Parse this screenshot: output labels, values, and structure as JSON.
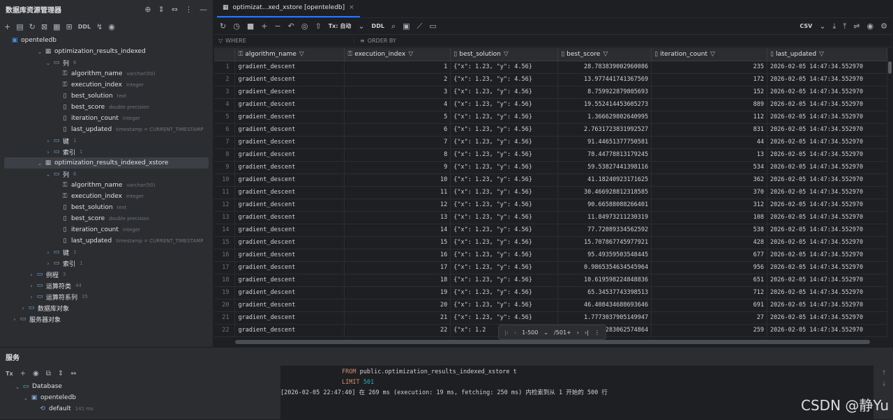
{
  "left_panel": {
    "title": "数据库资源管理器",
    "toolbar_ddl": "DDL",
    "tree": [
      {
        "depth": 0,
        "twist": "",
        "icon": "db",
        "label": "openteledb",
        "hint": ""
      },
      {
        "depth": 4,
        "twist": "⌄",
        "icon": "table",
        "label": "optimization_results_indexed",
        "hint": ""
      },
      {
        "depth": 5,
        "twist": "⌄",
        "icon": "folder",
        "label": "列",
        "hint": "6"
      },
      {
        "depth": 6,
        "twist": "",
        "icon": "key-col",
        "label": "algorithm_name",
        "hint": "varchar(50)"
      },
      {
        "depth": 6,
        "twist": "",
        "icon": "key-col",
        "label": "execution_index",
        "hint": "integer"
      },
      {
        "depth": 6,
        "twist": "",
        "icon": "col",
        "label": "best_solution",
        "hint": "text"
      },
      {
        "depth": 6,
        "twist": "",
        "icon": "col",
        "label": "best_score",
        "hint": "double precision"
      },
      {
        "depth": 6,
        "twist": "",
        "icon": "col",
        "label": "iteration_count",
        "hint": "integer"
      },
      {
        "depth": 6,
        "twist": "",
        "icon": "col",
        "label": "last_updated",
        "hint": "timestamp = CURRENT_TIMESTAMP"
      },
      {
        "depth": 5,
        "twist": "›",
        "icon": "folder",
        "label": "键",
        "hint": "1"
      },
      {
        "depth": 5,
        "twist": "›",
        "icon": "folder",
        "label": "索引",
        "hint": "1"
      },
      {
        "depth": 4,
        "twist": "⌄",
        "icon": "table",
        "label": "optimization_results_indexed_xstore",
        "hint": "",
        "selected": true
      },
      {
        "depth": 5,
        "twist": "⌄",
        "icon": "folder",
        "label": "列",
        "hint": "6"
      },
      {
        "depth": 6,
        "twist": "",
        "icon": "key-col",
        "label": "algorithm_name",
        "hint": "varchar(50)"
      },
      {
        "depth": 6,
        "twist": "",
        "icon": "key-col",
        "label": "execution_index",
        "hint": "integer"
      },
      {
        "depth": 6,
        "twist": "",
        "icon": "col",
        "label": "best_solution",
        "hint": "text"
      },
      {
        "depth": 6,
        "twist": "",
        "icon": "col",
        "label": "best_score",
        "hint": "double precision"
      },
      {
        "depth": 6,
        "twist": "",
        "icon": "col",
        "label": "iteration_count",
        "hint": "integer"
      },
      {
        "depth": 6,
        "twist": "",
        "icon": "col",
        "label": "last_updated",
        "hint": "timestamp = CURRENT_TIMESTAMP"
      },
      {
        "depth": 5,
        "twist": "›",
        "icon": "folder",
        "label": "键",
        "hint": "1"
      },
      {
        "depth": 5,
        "twist": "›",
        "icon": "folder",
        "label": "索引",
        "hint": "1"
      },
      {
        "depth": 3,
        "twist": "›",
        "icon": "folder",
        "label": "例程",
        "hint": "3"
      },
      {
        "depth": 3,
        "twist": "›",
        "icon": "folder",
        "label": "运算符类",
        "hint": "44"
      },
      {
        "depth": 3,
        "twist": "›",
        "icon": "folder",
        "label": "运算符系列",
        "hint": "35"
      },
      {
        "depth": 2,
        "twist": "›",
        "icon": "folder",
        "label": "数据库对象",
        "hint": ""
      },
      {
        "depth": 1,
        "twist": "›",
        "icon": "folder",
        "label": "服务器对象",
        "hint": ""
      }
    ]
  },
  "editor": {
    "tab_label": "optimizat...xed_xstore [openteledb]",
    "tx_label": "Tx: 自动",
    "ddl_label": "DDL",
    "export_format": "CSV",
    "where_label": "WHERE",
    "order_label": "ORDER BY"
  },
  "grid": {
    "columns": [
      "algorithm_name",
      "execution_index",
      "best_solution",
      "best_score",
      "iteration_count",
      "last_updated"
    ],
    "rows": [
      [
        "1",
        "gradient_descent",
        "1",
        "{\"x\": 1.23, \"y\": 4.56}",
        "28.783839002960086",
        "235",
        "2026-02-05 14:47:34.552970"
      ],
      [
        "2",
        "gradient_descent",
        "2",
        "{\"x\": 1.23, \"y\": 4.56}",
        "13.977441741367569",
        "172",
        "2026-02-05 14:47:34.552970"
      ],
      [
        "3",
        "gradient_descent",
        "3",
        "{\"x\": 1.23, \"y\": 4.56}",
        "8.759922879805693",
        "152",
        "2026-02-05 14:47:34.552970"
      ],
      [
        "4",
        "gradient_descent",
        "4",
        "{\"x\": 1.23, \"y\": 4.56}",
        "19.552414453605273",
        "889",
        "2026-02-05 14:47:34.552970"
      ],
      [
        "5",
        "gradient_descent",
        "5",
        "{\"x\": 1.23, \"y\": 4.56}",
        "1.366629802640995",
        "112",
        "2026-02-05 14:47:34.552970"
      ],
      [
        "6",
        "gradient_descent",
        "6",
        "{\"x\": 1.23, \"y\": 4.56}",
        "2.7631723831992527",
        "831",
        "2026-02-05 14:47:34.552970"
      ],
      [
        "7",
        "gradient_descent",
        "7",
        "{\"x\": 1.23, \"y\": 4.56}",
        "91.44651377750581",
        "44",
        "2026-02-05 14:47:34.552970"
      ],
      [
        "8",
        "gradient_descent",
        "8",
        "{\"x\": 1.23, \"y\": 4.56}",
        "78.44778813179245",
        "13",
        "2026-02-05 14:47:34.552970"
      ],
      [
        "9",
        "gradient_descent",
        "9",
        "{\"x\": 1.23, \"y\": 4.56}",
        "59.53827441398116",
        "534",
        "2026-02-05 14:47:34.552970"
      ],
      [
        "10",
        "gradient_descent",
        "10",
        "{\"x\": 1.23, \"y\": 4.56}",
        "41.18240923171625",
        "362",
        "2026-02-05 14:47:34.552970"
      ],
      [
        "11",
        "gradient_descent",
        "11",
        "{\"x\": 1.23, \"y\": 4.56}",
        "30.466928812318585",
        "370",
        "2026-02-05 14:47:34.552970"
      ],
      [
        "12",
        "gradient_descent",
        "12",
        "{\"x\": 1.23, \"y\": 4.56}",
        "90.66588088266401",
        "312",
        "2026-02-05 14:47:34.552970"
      ],
      [
        "13",
        "gradient_descent",
        "13",
        "{\"x\": 1.23, \"y\": 4.56}",
        "11.84973211230319",
        "108",
        "2026-02-05 14:47:34.552970"
      ],
      [
        "14",
        "gradient_descent",
        "14",
        "{\"x\": 1.23, \"y\": 4.56}",
        "77.72089334562592",
        "538",
        "2026-02-05 14:47:34.552970"
      ],
      [
        "15",
        "gradient_descent",
        "15",
        "{\"x\": 1.23, \"y\": 4.56}",
        "15.707867745977921",
        "428",
        "2026-02-05 14:47:34.552970"
      ],
      [
        "16",
        "gradient_descent",
        "16",
        "{\"x\": 1.23, \"y\": 4.56}",
        "95.49359503548445",
        "677",
        "2026-02-05 14:47:34.552970"
      ],
      [
        "17",
        "gradient_descent",
        "17",
        "{\"x\": 1.23, \"y\": 4.56}",
        "0.9865354634545964",
        "956",
        "2026-02-05 14:47:34.552970"
      ],
      [
        "18",
        "gradient_descent",
        "18",
        "{\"x\": 1.23, \"y\": 4.56}",
        "10.619598224848836",
        "651",
        "2026-02-05 14:47:34.552970"
      ],
      [
        "19",
        "gradient_descent",
        "19",
        "{\"x\": 1.23, \"y\": 4.56}",
        "65.34537743398513",
        "712",
        "2026-02-05 14:47:34.552970"
      ],
      [
        "20",
        "gradient_descent",
        "20",
        "{\"x\": 1.23, \"y\": 4.56}",
        "46.408434688693646",
        "691",
        "2026-02-05 14:47:34.552970"
      ],
      [
        "21",
        "gradient_descent",
        "21",
        "{\"x\": 1.23, \"y\": 4.56}",
        "1.7773037905149947",
        "27",
        "2026-02-05 14:47:34.552970"
      ],
      [
        "22",
        "gradient_descent",
        "22",
        "{\"x\": 1.2",
        "…86283062574864",
        "259",
        "2026-02-05 14:47:34.552970"
      ]
    ]
  },
  "pager": {
    "range": "1-500",
    "total": "/501+"
  },
  "services": {
    "title": "服务",
    "tx_label": "Tx",
    "tree": [
      {
        "depth": 1,
        "twist": "⌄",
        "label": "Database",
        "hint": ""
      },
      {
        "depth": 2,
        "twist": "⌄",
        "label": "openteledb",
        "hint": ""
      },
      {
        "depth": 3,
        "twist": "",
        "label": "default",
        "hint": "141 ms"
      }
    ],
    "console": {
      "line1_kw": "FROM",
      "line1_rest": " public.optimization_results_indexed_xstore t",
      "line2_kw": "LIMIT",
      "line2_num": "501",
      "line3": "[2026-02-05 22:47:40] 在 269 ms (execution: 19 ms, fetching: 250 ms) 内检索到从 1 开始的 500 行"
    }
  },
  "watermark": "CSDN @静Yu",
  "colors": {
    "accent": "#3574f0",
    "keyword": "#cf8e6d",
    "number": "#2aacb8"
  }
}
